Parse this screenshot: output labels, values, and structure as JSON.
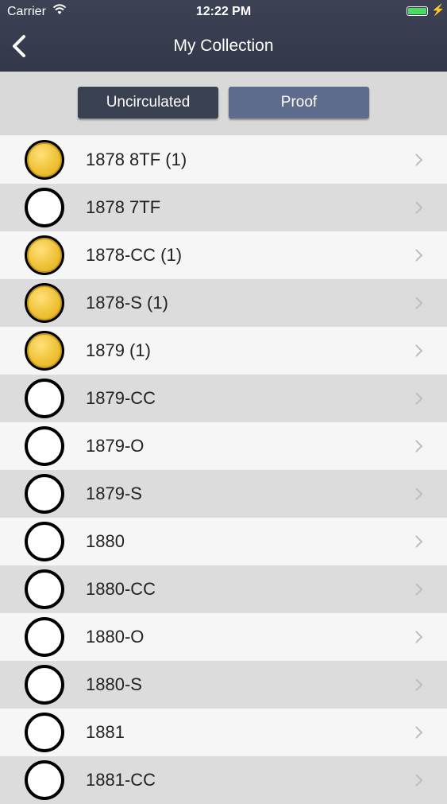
{
  "status_bar": {
    "carrier": "Carrier",
    "time": "12:22 PM",
    "battery_color": "#4cd964"
  },
  "nav": {
    "title": "My Collection",
    "back_icon": "chevron-left-icon"
  },
  "segments": {
    "uncirculated": "Uncirculated",
    "proof": "Proof"
  },
  "coins": [
    {
      "label": "1878 8TF (1)",
      "owned": true
    },
    {
      "label": "1878 7TF",
      "owned": false
    },
    {
      "label": "1878-CC (1)",
      "owned": true
    },
    {
      "label": "1878-S (1)",
      "owned": true
    },
    {
      "label": "1879 (1)",
      "owned": true
    },
    {
      "label": "1879-CC",
      "owned": false
    },
    {
      "label": "1879-O",
      "owned": false
    },
    {
      "label": "1879-S",
      "owned": false
    },
    {
      "label": "1880",
      "owned": false
    },
    {
      "label": "1880-CC",
      "owned": false
    },
    {
      "label": "1880-O",
      "owned": false
    },
    {
      "label": "1880-S",
      "owned": false
    },
    {
      "label": "1881",
      "owned": false
    },
    {
      "label": "1881-CC",
      "owned": false
    }
  ]
}
